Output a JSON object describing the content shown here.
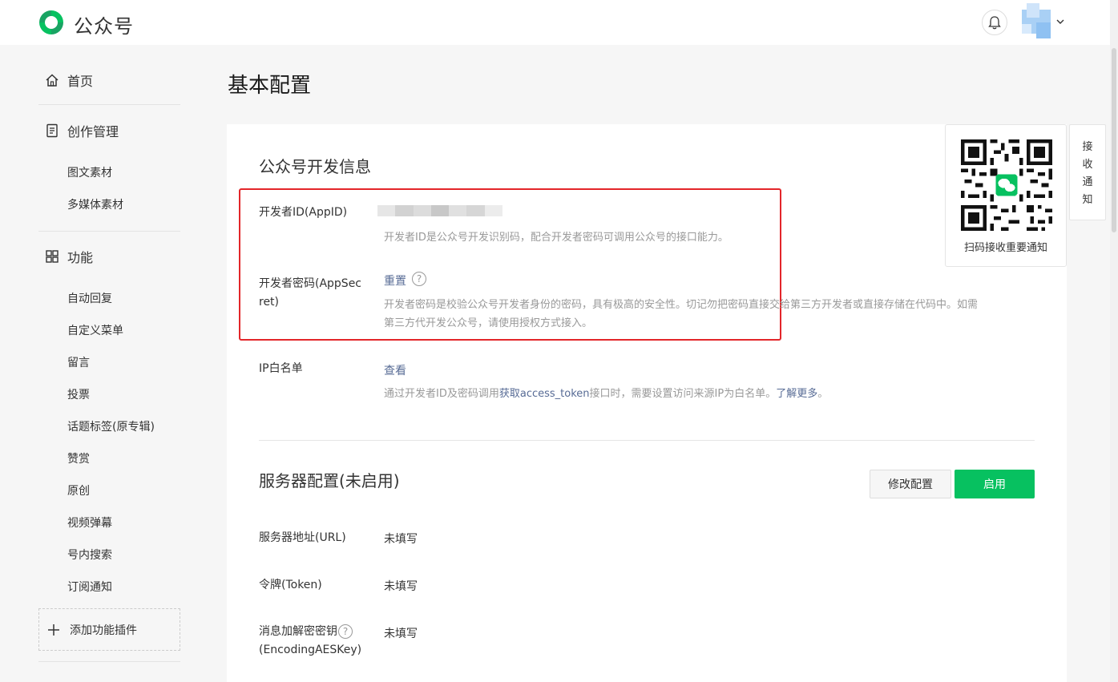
{
  "app": {
    "title": "公众号"
  },
  "sidebar": {
    "home": "首页",
    "creation": "创作管理",
    "creation_items": [
      "图文素材",
      "多媒体素材"
    ],
    "features": "功能",
    "feature_items": [
      "自动回复",
      "自定义菜单",
      "留言",
      "投票",
      "话题标签(原专辑)",
      "赞赏",
      "原创",
      "视频弹幕",
      "号内搜索",
      "订阅通知"
    ],
    "add_plugin": "添加功能插件"
  },
  "page": {
    "title": "基本配置"
  },
  "dev_info": {
    "title": "公众号开发信息",
    "appid_label": "开发者ID(AppID)",
    "appid_desc": "开发者ID是公众号开发识别码，配合开发者密码可调用公众号的接口能力。",
    "secret_label_1": "开发者密码(AppSec",
    "secret_label_2": "ret)",
    "secret_action": "重置",
    "secret_help": "?",
    "secret_desc_1": "开发者密码是校验公众号开发者身份的密码，具有极高的安全性。切记勿把密码直接交给第三方开发者或直接存储在代码中。如需",
    "secret_desc_2": "第三方代开发公众号，请使用授权方式接入。",
    "ip_label": "IP白名单",
    "ip_action": "查看",
    "ip_desc_pre": "通过开发者ID及密码调用",
    "ip_desc_link": "获取access_token",
    "ip_desc_mid": "接口时，需要设置访问来源IP为白名单。",
    "ip_desc_more": "了解更多",
    "ip_desc_end": "。"
  },
  "server": {
    "title": "服务器配置(未启用)",
    "modify_button": "修改配置",
    "enable_button": "启用",
    "url_label": "服务器地址(URL)",
    "url_value": "未填写",
    "token_label": "令牌(Token)",
    "token_value": "未填写",
    "aes_label_1": "消息加解密密钥",
    "aes_label_2": "(EncodingAESKey)",
    "aes_help": "?",
    "aes_value": "未填写"
  },
  "qr": {
    "caption": "扫码接收重要通知"
  },
  "notice_tab": {
    "label": "接收通知"
  },
  "colors": {
    "accent": "#07c160",
    "link": "#576b95",
    "highlight_box": "#e3262a"
  }
}
